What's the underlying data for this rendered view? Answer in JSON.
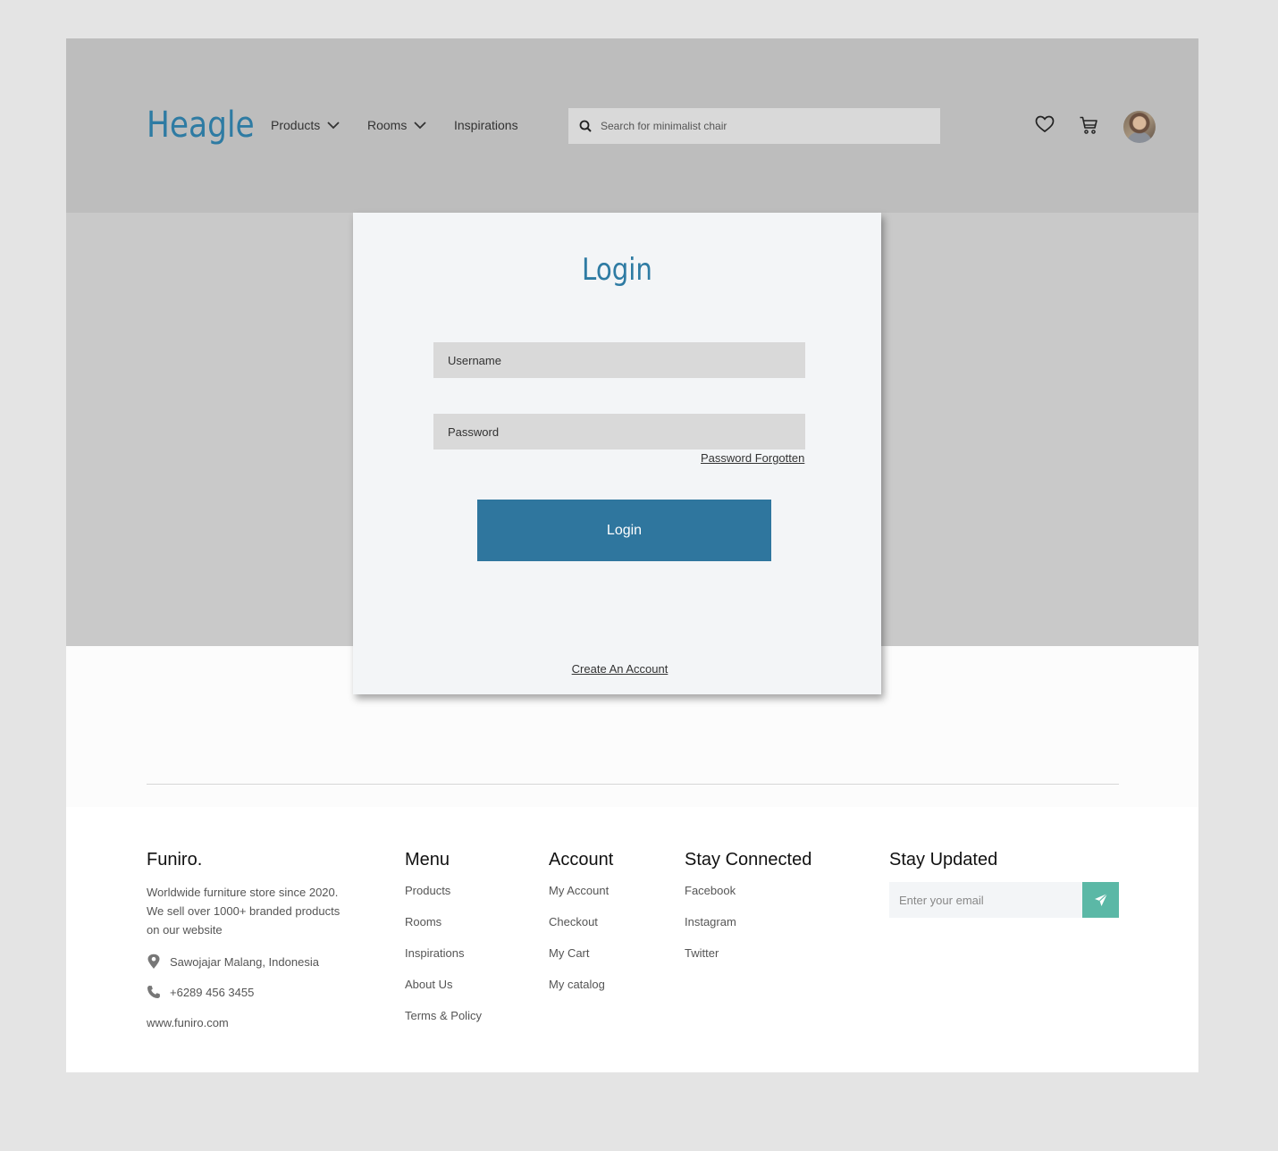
{
  "header": {
    "logo": "Heagle",
    "nav": [
      {
        "label": "Products",
        "has_dropdown": true
      },
      {
        "label": "Rooms",
        "has_dropdown": true
      },
      {
        "label": "Inspirations",
        "has_dropdown": false
      }
    ],
    "search": {
      "placeholder": "Search for minimalist chair",
      "icon": "search-icon"
    },
    "icons": [
      "heart-icon",
      "cart-icon",
      "avatar"
    ]
  },
  "login": {
    "title": "Login",
    "username_placeholder": "Username",
    "password_placeholder": "Password",
    "forgot_label": "Password Forgotten",
    "button_label": "Login",
    "create_account_label": "Create An Account"
  },
  "footer": {
    "brand": {
      "title": "Funiro.",
      "description": "Worldwide furniture store since 2020. We sell over 1000+ branded products on our website",
      "address": "Sawojajar Malang, Indonesia",
      "phone": "+6289 456 3455",
      "website": "www.funiro.com"
    },
    "menu": {
      "title": "Menu",
      "items": [
        "Products",
        "Rooms",
        "Inspirations",
        "About Us",
        "Terms & Policy"
      ]
    },
    "account": {
      "title": "Account",
      "items": [
        "My Account",
        "Checkout",
        "My Cart",
        "My catalog"
      ]
    },
    "social": {
      "title": "Stay Connected",
      "items": [
        "Facebook",
        "Instagram",
        "Twitter"
      ]
    },
    "newsletter": {
      "title": "Stay Updated",
      "placeholder": "Enter your email"
    }
  },
  "colors": {
    "brand": "#2e7ba3",
    "button": "#2f769e",
    "send": "#5bb8a6"
  }
}
